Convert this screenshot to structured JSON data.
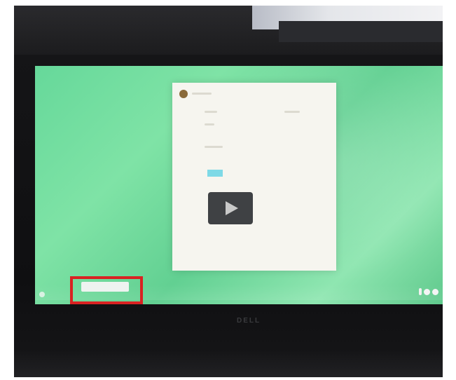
{
  "screen": {
    "taskbar_window_label": "",
    "tray_chip_label": "",
    "brand": "DELL"
  },
  "colors": {
    "desktop_wallpaper": "#66d89a",
    "card_background": "#f6f5ef",
    "highlight": "#d92222",
    "play_overlay": "#3f4144"
  },
  "icons": {
    "play": "play-icon",
    "launcher": "launcher-icon",
    "status": "status-icon"
  }
}
